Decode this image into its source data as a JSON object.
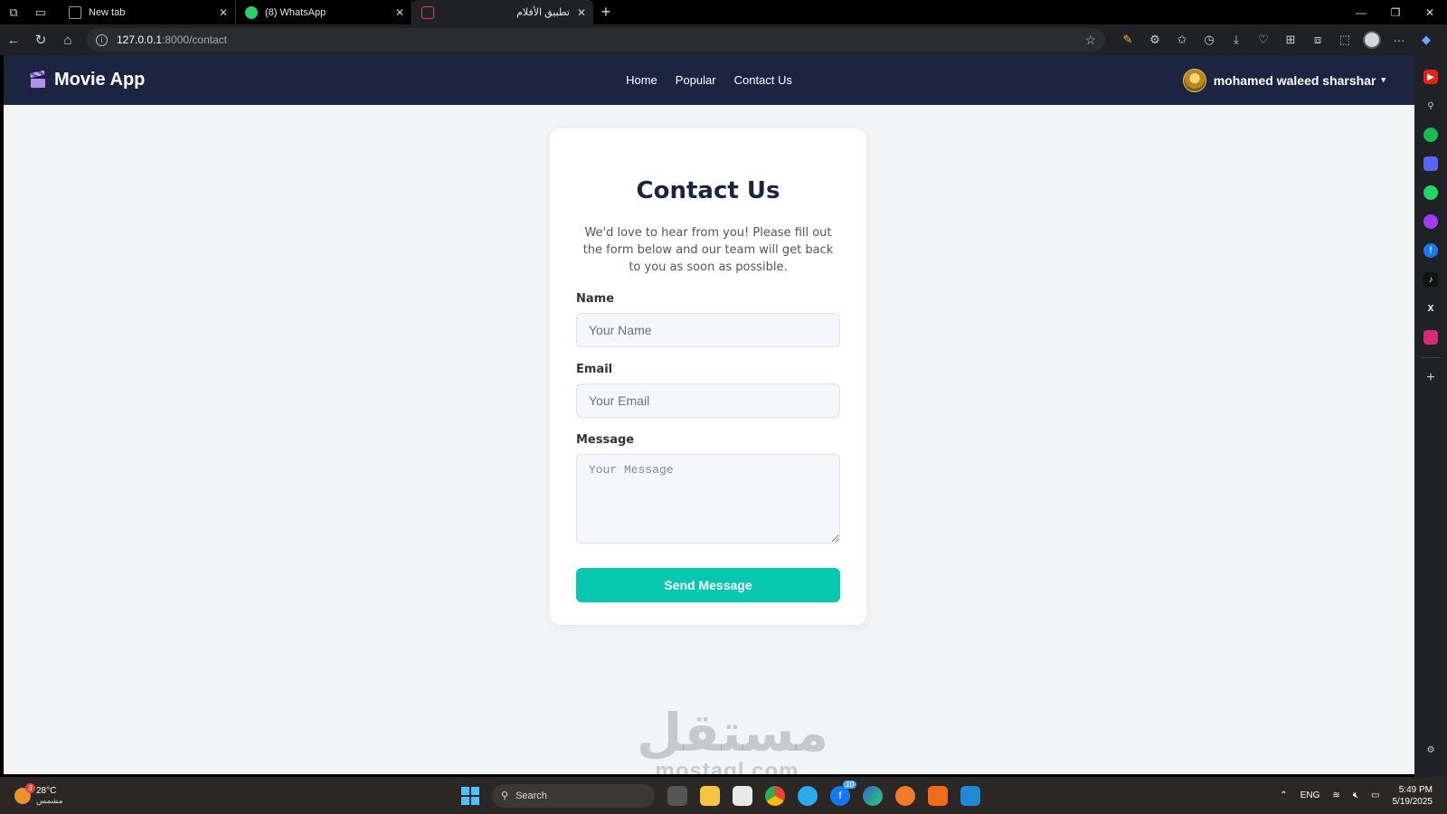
{
  "browser": {
    "tabs": [
      {
        "title": "New tab"
      },
      {
        "title": "(8) WhatsApp"
      },
      {
        "title": "تطبيق الأفلام"
      }
    ],
    "url_host": "127.0.0.1",
    "url_path": ":8000/contact"
  },
  "navbar": {
    "brand": "Movie App",
    "links": [
      "Home",
      "Popular",
      "Contact Us"
    ],
    "user_name": "mohamed waleed sharshar"
  },
  "contact": {
    "title": "Contact Us",
    "intro": "We'd love to hear from you! Please fill out the form below and our team will get back to you as soon as possible.",
    "name_label": "Name",
    "name_placeholder": "Your Name",
    "email_label": "Email",
    "email_placeholder": "Your Email",
    "message_label": "Message",
    "message_placeholder": "Your Message",
    "submit_label": "Send Message"
  },
  "watermark": {
    "arabic": "مستقل",
    "latin": "mostaql.com"
  },
  "taskbar": {
    "temperature": "28°C",
    "weather_text": "مشمس",
    "weather_badge": "3",
    "search_label": "Search",
    "facebook_badge": "10",
    "language": "ENG",
    "time": "5:49 PM",
    "date": "5/19/2025"
  },
  "colors": {
    "navbar_bg": "#1b2440",
    "accent": "#08c7b0",
    "page_bg": "#f3f4f6"
  }
}
